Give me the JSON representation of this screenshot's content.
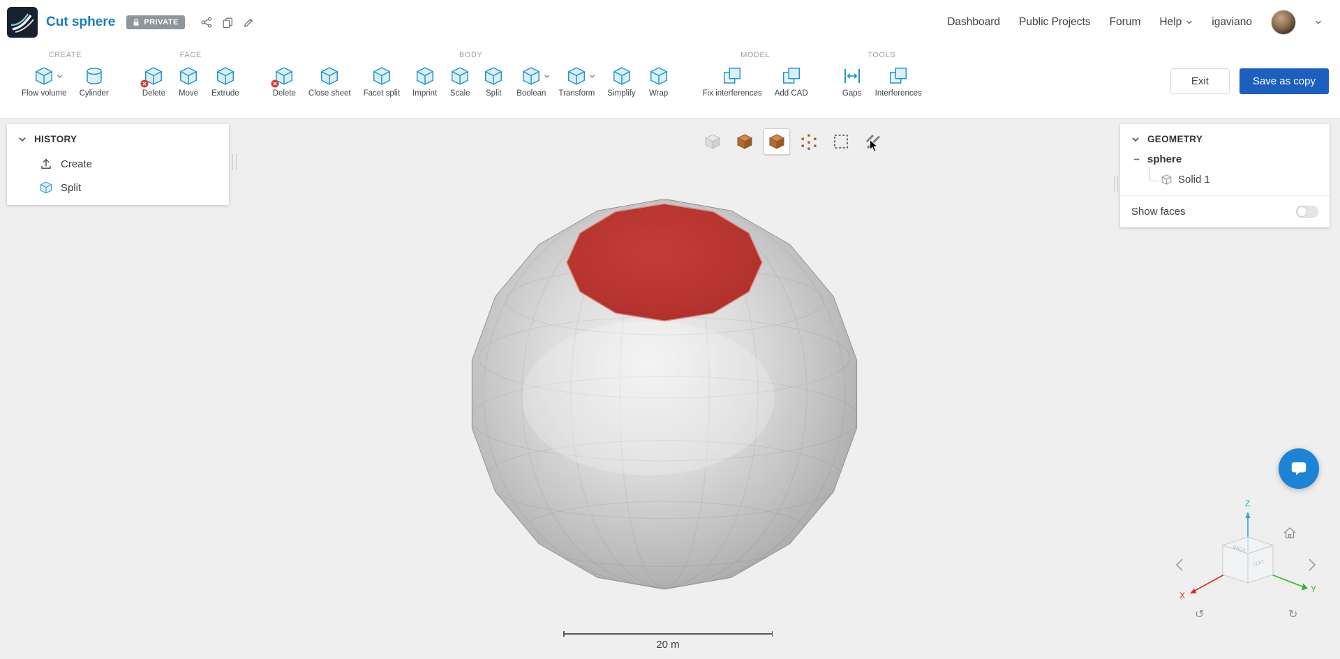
{
  "header": {
    "title": "Cut sphere",
    "privacy_badge": "PRIVATE",
    "nav_items": [
      "Dashboard",
      "Public Projects",
      "Forum",
      "Help"
    ],
    "username": "igaviano"
  },
  "ribbon": {
    "groups": [
      {
        "label": "CREATE",
        "items": [
          {
            "label": "Flow volume",
            "has_dropdown": true
          },
          {
            "label": "Cylinder"
          }
        ]
      },
      {
        "label": "FACE",
        "items": [
          {
            "label": "Delete"
          },
          {
            "label": "Move"
          },
          {
            "label": "Extrude"
          }
        ]
      },
      {
        "label": "BODY",
        "items": [
          {
            "label": "Delete"
          },
          {
            "label": "Close sheet"
          },
          {
            "label": "Facet split"
          },
          {
            "label": "Imprint"
          },
          {
            "label": "Scale"
          },
          {
            "label": "Split"
          },
          {
            "label": "Boolean",
            "has_dropdown": true
          },
          {
            "label": "Transform",
            "has_dropdown": true
          },
          {
            "label": "Simplify"
          },
          {
            "label": "Wrap"
          }
        ]
      },
      {
        "label": "MODEL",
        "items": [
          {
            "label": "Fix interferences"
          },
          {
            "label": "Add CAD"
          }
        ]
      },
      {
        "label": "TOOLS",
        "items": [
          {
            "label": "Gaps"
          },
          {
            "label": "Interferences"
          }
        ]
      }
    ],
    "exit_button": "Exit",
    "save_button": "Save as copy"
  },
  "history_panel": {
    "title": "HISTORY",
    "items": [
      {
        "label": "Create"
      },
      {
        "label": "Split"
      }
    ]
  },
  "geometry_panel": {
    "title": "GEOMETRY",
    "tree_root": "sphere",
    "tree_child": "Solid 1",
    "show_faces_label": "Show faces",
    "show_faces_on": false
  },
  "viewport": {
    "scale_label": "20 m",
    "axis_x": "X",
    "axis_y": "Y",
    "axis_z": "Z",
    "cube_face_labels": [
      "BACK",
      "LEFT"
    ]
  },
  "icons": {
    "lock": "padlock",
    "share": "share-nodes",
    "duplicate": "copy",
    "rename": "pencil",
    "caret_down": "chevron-down",
    "history_create": "upload-arrow",
    "history_split": "blue-cube",
    "rotate_ccw": "curved-arrow-left",
    "rotate_cw": "curved-arrow-right",
    "chat": "chat-bubble",
    "home": "house"
  },
  "colors": {
    "brand_blue": "#1a7db6",
    "tool_icon_blue": "#2196c9",
    "save_button_blue": "#1d5fbe",
    "cut_face_red": "#b5332e",
    "axis_x_red": "#e0281e",
    "axis_y_green": "#2db52d",
    "axis_z_teal": "#27a9c9",
    "canvas_gray": "#efefef"
  }
}
